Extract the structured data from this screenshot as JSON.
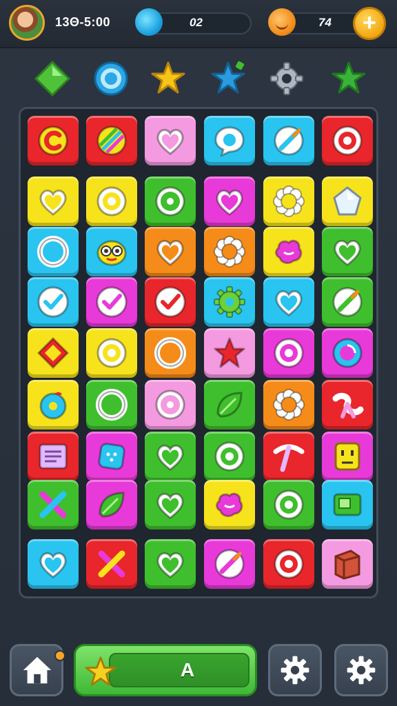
{
  "header": {
    "timer": "13Θ-5:00",
    "gems": "02",
    "coins": "74",
    "add_label": "+"
  },
  "boosters": [
    {
      "icon": "green-diamond-icon",
      "color": "#4fc23a"
    },
    {
      "icon": "blue-target-icon",
      "color": "#2aa7e6"
    },
    {
      "icon": "yellow-star-icon",
      "color": "#f5c518"
    },
    {
      "icon": "blue-star-icon",
      "color": "#2b9be0"
    },
    {
      "icon": "gear-icon",
      "color": "#aeb6c0"
    },
    {
      "icon": "green-star-icon",
      "color": "#3bb33a"
    }
  ],
  "board": {
    "rows": [
      [
        [
          "#e8262b",
          "c-letter-icon"
        ],
        [
          "#e8262b",
          "striped-ball-icon"
        ],
        [
          "#f49ae0",
          "heart-icon"
        ],
        [
          "#29c4f0",
          "bubble-icon"
        ],
        [
          "#29c4f0",
          "brush-icon"
        ],
        [
          "#e8262b",
          "target-icon"
        ]
      ],
      [
        [
          "#f7e31c",
          "heart-icon"
        ],
        [
          "#f7e31c",
          "target-icon"
        ],
        [
          "#3fbf2d",
          "donut-icon"
        ],
        [
          "#e83ad8",
          "heart-icon"
        ],
        [
          "#f7e31c",
          "flower-icon"
        ],
        [
          "#f7e31c",
          "gem-icon"
        ]
      ],
      [
        [
          "#29c4f0",
          "ring-icon"
        ],
        [
          "#29c4f0",
          "face-icon"
        ],
        [
          "#f58b18",
          "heart-icon"
        ],
        [
          "#f58b18",
          "flower-icon"
        ],
        [
          "#f7e31c",
          "blob-icon"
        ],
        [
          "#3fbf2d",
          "heart-icon"
        ]
      ],
      [
        [
          "#29c4f0",
          "check-icon"
        ],
        [
          "#e83ad8",
          "check-icon"
        ],
        [
          "#e8262b",
          "check-icon"
        ],
        [
          "#29c4f0",
          "gear-icon"
        ],
        [
          "#29c4f0",
          "heart-icon"
        ],
        [
          "#3fbf2d",
          "brush-icon"
        ]
      ],
      [
        [
          "#f7e31c",
          "diamond-icon"
        ],
        [
          "#f7e31c",
          "target-icon"
        ],
        [
          "#f58b18",
          "ring-icon"
        ],
        [
          "#f49ae0",
          "star-icon"
        ],
        [
          "#e83ad8",
          "target-icon"
        ],
        [
          "#e83ad8",
          "swirl-icon"
        ]
      ],
      [
        [
          "#f7e31c",
          "apple-icon"
        ],
        [
          "#3fbf2d",
          "ring-icon"
        ],
        [
          "#f49ae0",
          "donut-icon"
        ],
        [
          "#3fbf2d",
          "leaf-icon"
        ],
        [
          "#f58b18",
          "flower-icon"
        ],
        [
          "#e8262b",
          "ribbon-icon"
        ]
      ],
      [
        [
          "#e8262b",
          "note-icon"
        ],
        [
          "#e83ad8",
          "bandage-icon"
        ],
        [
          "#3fbf2d",
          "heart-icon"
        ],
        [
          "#3fbf2d",
          "target-icon"
        ],
        [
          "#e8262b",
          "pickaxe-icon"
        ],
        [
          "#e83ad8",
          "robot-icon"
        ]
      ],
      [
        [
          "#3fbf2d",
          "cross-icon"
        ],
        [
          "#e83ad8",
          "leaf-icon"
        ],
        [
          "#3fbf2d",
          "heart-icon"
        ],
        [
          "#f7e31c",
          "blob-icon"
        ],
        [
          "#3fbf2d",
          "target-icon"
        ],
        [
          "#29c4f0",
          "camera-icon"
        ]
      ],
      [
        [
          "#29c4f0",
          "heart-icon"
        ],
        [
          "#e8262b",
          "cross-icon"
        ],
        [
          "#3fbf2d",
          "heart-icon"
        ],
        [
          "#e83ad8",
          "brush-icon"
        ],
        [
          "#e8262b",
          "target-icon"
        ],
        [
          "#f49ae0",
          "crate-icon"
        ]
      ]
    ]
  },
  "footer": {
    "play_label": "A",
    "home_icon": "home-icon",
    "settings_icon_1": "gear-icon",
    "settings_icon_2": "gear-icon"
  }
}
